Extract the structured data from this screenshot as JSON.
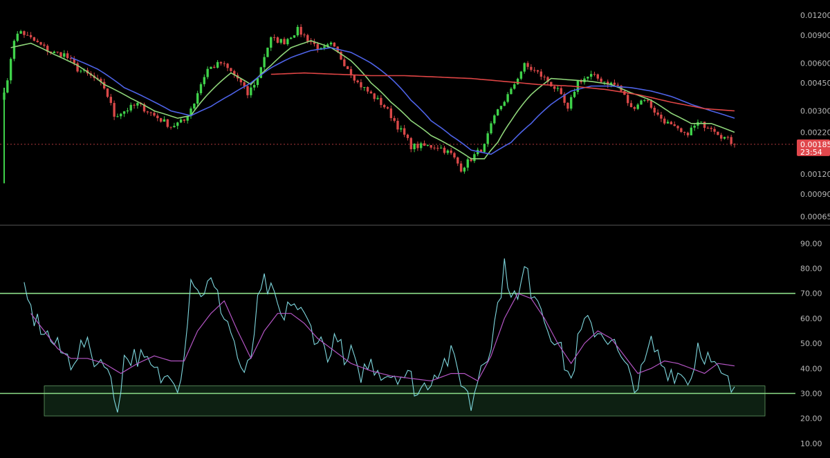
{
  "colors": {
    "background": "#000000",
    "candle_up": "#3fd24a",
    "candle_down": "#d94848",
    "ma_fast": "#8fd67a",
    "ma_mid": "#4e63e8",
    "ma_slow": "#e04545",
    "rsi_line": "#7fd8df",
    "rsi_ma": "#b455c4",
    "band_line": "#8ee08a",
    "band_fill": "#0f2414",
    "divider": "#3a3a3a",
    "axis_text": "#b8b8b8",
    "price_tag": "#e0474c"
  },
  "chart_data": [
    {
      "type": "candlestick",
      "panel": "price",
      "scale": "log",
      "ylim": [
        0.00055,
        0.0125
      ],
      "y_ticks": [
        "0.01200",
        "0.00900",
        "0.00600",
        "0.00450",
        "0.00300",
        "0.00220",
        "0.00120",
        "0.00090",
        "0.00065"
      ],
      "current_price": "0.00185",
      "countdown": "23:54",
      "candle_count": 220,
      "close_anchors": [
        [
          0,
          0.0041
        ],
        [
          1,
          0.0045
        ],
        [
          3,
          0.0085
        ],
        [
          5,
          0.0095
        ],
        [
          7,
          0.0088
        ],
        [
          10,
          0.008
        ],
        [
          14,
          0.007
        ],
        [
          18,
          0.0068
        ],
        [
          22,
          0.0055
        ],
        [
          27,
          0.0048
        ],
        [
          30,
          0.0042
        ],
        [
          33,
          0.0028
        ],
        [
          36,
          0.003
        ],
        [
          40,
          0.0033
        ],
        [
          45,
          0.0028
        ],
        [
          50,
          0.0024
        ],
        [
          54,
          0.0026
        ],
        [
          57,
          0.0034
        ],
        [
          61,
          0.0055
        ],
        [
          65,
          0.006
        ],
        [
          70,
          0.0048
        ],
        [
          73,
          0.0038
        ],
        [
          76,
          0.0048
        ],
        [
          80,
          0.0085
        ],
        [
          84,
          0.0082
        ],
        [
          88,
          0.0097
        ],
        [
          91,
          0.0085
        ],
        [
          95,
          0.0072
        ],
        [
          98,
          0.0078
        ],
        [
          102,
          0.006
        ],
        [
          106,
          0.0045
        ],
        [
          110,
          0.0038
        ],
        [
          114,
          0.0032
        ],
        [
          118,
          0.0024
        ],
        [
          122,
          0.0018
        ],
        [
          126,
          0.0018
        ],
        [
          130,
          0.0018
        ],
        [
          134,
          0.0016
        ],
        [
          137,
          0.0013
        ],
        [
          140,
          0.0015
        ],
        [
          144,
          0.0018
        ],
        [
          148,
          0.003
        ],
        [
          152,
          0.004
        ],
        [
          156,
          0.0058
        ],
        [
          160,
          0.0052
        ],
        [
          163,
          0.0046
        ],
        [
          166,
          0.004
        ],
        [
          169,
          0.003
        ],
        [
          172,
          0.0046
        ],
        [
          176,
          0.005
        ],
        [
          180,
          0.0046
        ],
        [
          184,
          0.0043
        ],
        [
          188,
          0.0031
        ],
        [
          192,
          0.0036
        ],
        [
          196,
          0.0028
        ],
        [
          200,
          0.0024
        ],
        [
          204,
          0.0021
        ],
        [
          208,
          0.0025
        ],
        [
          212,
          0.0024
        ],
        [
          215,
          0.0021
        ],
        [
          219,
          0.00185
        ]
      ],
      "overlays": [
        {
          "name": "",
          "color": "ma_fast",
          "anchors": [
            [
              2,
              0.0075
            ],
            [
              8,
              0.008
            ],
            [
              15,
              0.0068
            ],
            [
              22,
              0.0058
            ],
            [
              30,
              0.0044
            ],
            [
              38,
              0.0036
            ],
            [
              45,
              0.003
            ],
            [
              52,
              0.0027
            ],
            [
              56,
              0.0028
            ],
            [
              62,
              0.004
            ],
            [
              68,
              0.0052
            ],
            [
              74,
              0.0044
            ],
            [
              80,
              0.0058
            ],
            [
              86,
              0.0075
            ],
            [
              92,
              0.0083
            ],
            [
              98,
              0.0075
            ],
            [
              104,
              0.0062
            ],
            [
              110,
              0.0045
            ],
            [
              116,
              0.0034
            ],
            [
              122,
              0.0026
            ],
            [
              128,
              0.0021
            ],
            [
              134,
              0.0018
            ],
            [
              140,
              0.0015
            ],
            [
              144,
              0.0015
            ],
            [
              148,
              0.0019
            ],
            [
              152,
              0.0026
            ],
            [
              158,
              0.0038
            ],
            [
              164,
              0.0048
            ],
            [
              170,
              0.0047
            ],
            [
              176,
              0.0046
            ],
            [
              182,
              0.0044
            ],
            [
              188,
              0.0039
            ],
            [
              194,
              0.0035
            ],
            [
              200,
              0.0029
            ],
            [
              206,
              0.0025
            ],
            [
              212,
              0.0025
            ],
            [
              219,
              0.0022
            ]
          ]
        },
        {
          "name": "",
          "color": "ma_mid",
          "anchors": [
            [
              20,
              0.0065
            ],
            [
              28,
              0.0055
            ],
            [
              36,
              0.0042
            ],
            [
              44,
              0.0035
            ],
            [
              50,
              0.003
            ],
            [
              56,
              0.0028
            ],
            [
              62,
              0.0032
            ],
            [
              68,
              0.0038
            ],
            [
              74,
              0.0045
            ],
            [
              80,
              0.0056
            ],
            [
              86,
              0.0065
            ],
            [
              92,
              0.0072
            ],
            [
              98,
              0.0075
            ],
            [
              104,
              0.007
            ],
            [
              110,
              0.006
            ],
            [
              116,
              0.0048
            ],
            [
              122,
              0.0035
            ],
            [
              128,
              0.0026
            ],
            [
              134,
              0.0021
            ],
            [
              140,
              0.0017
            ],
            [
              146,
              0.0016
            ],
            [
              152,
              0.0019
            ],
            [
              158,
              0.0025
            ],
            [
              164,
              0.0033
            ],
            [
              170,
              0.004
            ],
            [
              176,
              0.0043
            ],
            [
              182,
              0.0043
            ],
            [
              188,
              0.0042
            ],
            [
              194,
              0.004
            ],
            [
              200,
              0.0037
            ],
            [
              206,
              0.0033
            ],
            [
              212,
              0.003
            ],
            [
              219,
              0.0027
            ]
          ]
        },
        {
          "name": "",
          "color": "ma_slow",
          "anchors": [
            [
              80,
              0.0051
            ],
            [
              90,
              0.0052
            ],
            [
              100,
              0.0051
            ],
            [
              110,
              0.005
            ],
            [
              120,
              0.005
            ],
            [
              130,
              0.0049
            ],
            [
              140,
              0.0048
            ],
            [
              150,
              0.0046
            ],
            [
              160,
              0.0044
            ],
            [
              170,
              0.0043
            ],
            [
              180,
              0.0041
            ],
            [
              190,
              0.0038
            ],
            [
              200,
              0.0034
            ],
            [
              210,
              0.0031
            ],
            [
              219,
              0.003
            ]
          ]
        }
      ]
    },
    {
      "type": "line",
      "panel": "rsi",
      "ylim": [
        5,
        97
      ],
      "y_ticks": [
        "90.00",
        "80.00",
        "70.00",
        "60.00",
        "50.00",
        "40.00",
        "30.00",
        "20.00",
        "10.00"
      ],
      "levels": [
        70,
        30
      ],
      "highlight_zone": [
        21,
        33
      ],
      "point_count": 220,
      "series": [
        {
          "name": "",
          "color": "rsi_line",
          "anchors": [
            [
              6,
              70
            ],
            [
              9,
              60
            ],
            [
              12,
              55
            ],
            [
              16,
              48
            ],
            [
              20,
              43
            ],
            [
              24,
              50
            ],
            [
              28,
              42
            ],
            [
              30,
              45
            ],
            [
              33,
              28
            ],
            [
              34,
              25
            ],
            [
              36,
              44
            ],
            [
              40,
              45
            ],
            [
              44,
              40
            ],
            [
              48,
              35
            ],
            [
              50,
              40
            ],
            [
              52,
              34
            ],
            [
              54,
              45
            ],
            [
              56,
              78
            ],
            [
              58,
              70
            ],
            [
              62,
              74
            ],
            [
              65,
              65
            ],
            [
              68,
              55
            ],
            [
              70,
              45
            ],
            [
              72,
              35
            ],
            [
              74,
              45
            ],
            [
              76,
              65
            ],
            [
              78,
              74
            ],
            [
              80,
              70
            ],
            [
              84,
              58
            ],
            [
              86,
              68
            ],
            [
              90,
              60
            ],
            [
              94,
              52
            ],
            [
              98,
              45
            ],
            [
              100,
              55
            ],
            [
              102,
              40
            ],
            [
              104,
              46
            ],
            [
              106,
              37
            ],
            [
              110,
              42
            ],
            [
              114,
              38
            ],
            [
              118,
              38
            ],
            [
              122,
              36
            ],
            [
              124,
              30
            ],
            [
              126,
              33
            ],
            [
              130,
              40
            ],
            [
              134,
              45
            ],
            [
              138,
              33
            ],
            [
              140,
              25
            ],
            [
              143,
              42
            ],
            [
              146,
              50
            ],
            [
              150,
              80
            ],
            [
              152,
              72
            ],
            [
              154,
              66
            ],
            [
              156,
              80
            ],
            [
              158,
              72
            ],
            [
              160,
              70
            ],
            [
              162,
              60
            ],
            [
              166,
              50
            ],
            [
              170,
              35
            ],
            [
              172,
              50
            ],
            [
              174,
              58
            ],
            [
              178,
              55
            ],
            [
              182,
              52
            ],
            [
              186,
              40
            ],
            [
              190,
              33
            ],
            [
              194,
              50
            ],
            [
              198,
              40
            ],
            [
              202,
              38
            ],
            [
              206,
              36
            ],
            [
              208,
              50
            ],
            [
              210,
              46
            ],
            [
              214,
              38
            ],
            [
              217,
              34
            ],
            [
              219,
              29
            ]
          ]
        },
        {
          "name": "",
          "color": "rsi_ma",
          "anchors": [
            [
              8,
              62
            ],
            [
              12,
              55
            ],
            [
              16,
              48
            ],
            [
              20,
              44
            ],
            [
              25,
              44
            ],
            [
              30,
              42
            ],
            [
              35,
              38
            ],
            [
              40,
              42
            ],
            [
              45,
              45
            ],
            [
              50,
              43
            ],
            [
              54,
              43
            ],
            [
              58,
              55
            ],
            [
              62,
              62
            ],
            [
              66,
              67
            ],
            [
              70,
              55
            ],
            [
              74,
              44
            ],
            [
              78,
              55
            ],
            [
              82,
              62
            ],
            [
              86,
              62
            ],
            [
              90,
              58
            ],
            [
              94,
              52
            ],
            [
              98,
              48
            ],
            [
              104,
              42
            ],
            [
              110,
              39
            ],
            [
              116,
              37
            ],
            [
              122,
              36
            ],
            [
              128,
              35
            ],
            [
              134,
              38
            ],
            [
              138,
              38
            ],
            [
              142,
              35
            ],
            [
              146,
              45
            ],
            [
              150,
              60
            ],
            [
              154,
              70
            ],
            [
              158,
              68
            ],
            [
              162,
              60
            ],
            [
              166,
              50
            ],
            [
              170,
              42
            ],
            [
              174,
              50
            ],
            [
              178,
              55
            ],
            [
              182,
              52
            ],
            [
              186,
              45
            ],
            [
              190,
              38
            ],
            [
              194,
              40
            ],
            [
              198,
              43
            ],
            [
              202,
              42
            ],
            [
              206,
              40
            ],
            [
              210,
              38
            ],
            [
              214,
              42
            ],
            [
              219,
              41
            ]
          ]
        }
      ]
    }
  ]
}
